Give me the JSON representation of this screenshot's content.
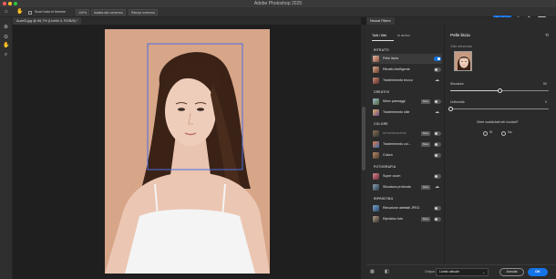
{
  "window": {
    "title": "Adobe Photoshop 2025"
  },
  "options_bar": {
    "scroll_all_label": "Scorri tutte le finestre",
    "zoom_100_label": "100%",
    "fit_screen_label": "Adatta allo schermo",
    "fill_screen_label": "Riempi schermo",
    "share_label": "Condividi"
  },
  "document": {
    "tab_label": "Aurel3.jpg @ 66,7% (Livello 0, RGB/8) *"
  },
  "neural_panel": {
    "title": "Neural Filters",
    "tabs": [
      {
        "label": "Tutti i filtri"
      },
      {
        "label": "In arrivo"
      }
    ],
    "categories": [
      {
        "name": "RITRATTI",
        "filters": [
          {
            "label": "Pelle liscia",
            "control": "toggle-on",
            "selected": true
          },
          {
            "label": "Ritratto intelligente",
            "control": "toggle-off"
          },
          {
            "label": "Trasferimento trucco",
            "control": "cloud"
          }
        ]
      },
      {
        "name": "CREATIVI",
        "filters": [
          {
            "label": "Mixer paesaggi",
            "badge": "Beta",
            "control": "toggle-off"
          },
          {
            "label": "Trasferimento stile",
            "control": "cloud"
          }
        ]
      },
      {
        "name": "COLORE",
        "filters": [
          {
            "label": "Armonizzazione",
            "badge": "Beta",
            "control": "toggle-off",
            "dim": true
          },
          {
            "label": "Trasferimento col...",
            "badge": "Beta",
            "control": "toggle-off"
          },
          {
            "label": "Colora",
            "control": "toggle-off"
          }
        ]
      },
      {
        "name": "FOTOGRAFIA",
        "filters": [
          {
            "label": "Super zoom",
            "control": "toggle-off"
          },
          {
            "label": "Sfocatura profonda",
            "badge": "Beta",
            "control": "cloud"
          }
        ]
      },
      {
        "name": "RIPRISTINO",
        "filters": [
          {
            "label": "Rimozione artefatti JPEG",
            "control": "toggle-off"
          },
          {
            "label": "Ripristino foto",
            "badge": "Beta",
            "control": "toggle-off"
          }
        ]
      }
    ]
  },
  "detail": {
    "title": "Pelle liscia",
    "face_label": "Volto selezionato",
    "sliders": [
      {
        "label": "Sfocatura",
        "value": "50",
        "level": 0.5
      },
      {
        "label": "Uniformità",
        "value": "0",
        "level": 0.0
      }
    ],
    "feedback_question": "Siete soddisfatti dei risultati?",
    "yes_label": "Sì",
    "no_label": "No"
  },
  "footer": {
    "output_label": "Output",
    "output_value": "Livello attuale",
    "cancel_label": "Annulla",
    "ok_label": "OK"
  },
  "colors": {
    "accent": "#1473e6",
    "panel": "#2b2b2b",
    "canvas_bg": "#1f1f1f"
  }
}
